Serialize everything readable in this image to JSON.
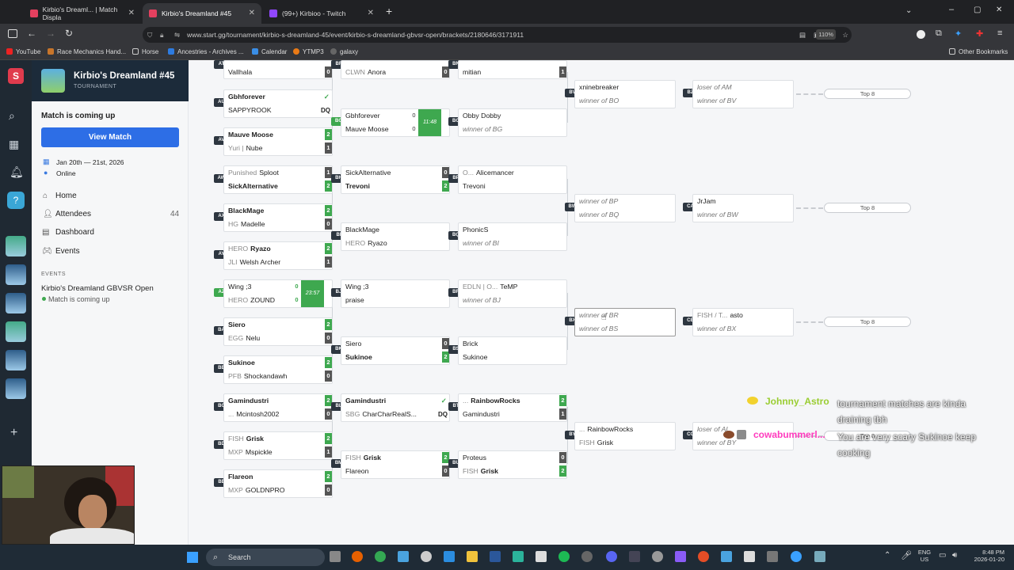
{
  "browser": {
    "tabs": [
      {
        "title": "Kirbio's Dreaml... | Match Displa"
      },
      {
        "title": "Kirbio's Dreamland #45"
      },
      {
        "title": "(99+) Kirbioo - Twitch"
      }
    ],
    "url": "www.start.gg/tournament/kirbio-s-dreamland-45/event/kirbio-s-dreamland-gbvsr-open/brackets/2180646/3171911",
    "zoom": "110%",
    "bookmarks": [
      "YouTube",
      "Race Mechanics Hand...",
      "Horse",
      "Ancestries - Archives ...",
      "Calendar",
      "YTMP3",
      "galaxy"
    ],
    "other_bookmarks": "Other Bookmarks"
  },
  "sidebar": {
    "tournament_name": "Kirbio's Dreamland #45",
    "tournament_tag": "TOURNAMENT",
    "match_status": "Match is coming up",
    "view_match": "View Match",
    "dates": "Jan 20th — 21st, 2026",
    "location": "Online",
    "nav": [
      {
        "label": "Home",
        "count": ""
      },
      {
        "label": "Attendees",
        "count": "44"
      },
      {
        "label": "Dashboard",
        "count": ""
      },
      {
        "label": "Events",
        "count": ""
      }
    ],
    "events_heading": "EVENTS",
    "event_name": "Kirbio's Dreamland GBVSR Open",
    "event_status": "Match is coming up"
  },
  "bracket": {
    "col1": [
      {
        "id": "AT",
        "p1": {
          "pre": "",
          "name": "Vallhala"
        },
        "s1": "0"
      },
      {
        "id": "AU",
        "p1": {
          "pre": "",
          "name": "Gbhforever",
          "b": true,
          "chk": true
        },
        "p2": {
          "pre": "",
          "name": "SAPPYROOK"
        },
        "s2": "DQ"
      },
      {
        "id": "AV",
        "p1": {
          "pre": "",
          "name": "Mauve Moose",
          "b": true
        },
        "s1": "2",
        "p2": {
          "pre": "Yuri |",
          "name": "Nube"
        },
        "s2": "1"
      },
      {
        "id": "AW",
        "p1": {
          "pre": "Punished",
          "name": "Sploot"
        },
        "s1": "1",
        "p2": {
          "pre": "",
          "name": "SickAlternative",
          "b": true
        },
        "s2": "2"
      },
      {
        "id": "AX",
        "p1": {
          "pre": "",
          "name": "BlackMage",
          "b": true
        },
        "s1": "2",
        "p2": {
          "pre": "HG",
          "name": "Madelle"
        },
        "s2": "0"
      },
      {
        "id": "AY",
        "p1": {
          "pre": "HERO",
          "name": "Ryazo",
          "b": true
        },
        "s1": "2",
        "p2": {
          "pre": "JLI",
          "name": "Welsh Archer"
        },
        "s2": "1"
      },
      {
        "id": "AZ",
        "p1": {
          "pre": "",
          "name": "Wing ;3"
        },
        "s1": "0",
        "p2": {
          "pre": "HERO",
          "name": "ZOUND"
        },
        "s2": "0",
        "timer": "23:57"
      },
      {
        "id": "BA",
        "p1": {
          "pre": "",
          "name": "Siero",
          "b": true
        },
        "s1": "2",
        "p2": {
          "pre": "EGG",
          "name": "Nelu"
        },
        "s2": "0"
      },
      {
        "id": "BB",
        "p1": {
          "pre": "",
          "name": "Sukinoe",
          "b": true
        },
        "s1": "2",
        "p2": {
          "pre": "PFB",
          "name": "Shockandawh"
        },
        "s2": "0"
      },
      {
        "id": "BC",
        "p1": {
          "pre": "",
          "name": "Gamindustri",
          "b": true
        },
        "s1": "2",
        "p2": {
          "pre": "...",
          "name": "Mcintosh2002"
        },
        "s2": "0"
      },
      {
        "id": "BD",
        "p1": {
          "pre": "FISH",
          "name": "Grisk",
          "b": true
        },
        "s1": "2",
        "p2": {
          "pre": "MXP",
          "name": "Mspickle"
        },
        "s2": "1"
      },
      {
        "id": "BE",
        "p1": {
          "pre": "",
          "name": "Flareon",
          "b": true
        },
        "s1": "2",
        "p2": {
          "pre": "MXP",
          "name": "GOLDNPRO"
        },
        "s2": "0"
      }
    ],
    "col2": [
      {
        "id": "BF",
        "p1": {
          "pre": "CLWN",
          "name": "Anora"
        },
        "s1": "0"
      },
      {
        "id": "BG",
        "p1": {
          "pre": "",
          "name": "Gbhforever"
        },
        "s1": "0",
        "p2": {
          "pre": "",
          "name": "Mauve Moose"
        },
        "s2": "0",
        "timer": "11:48"
      },
      {
        "id": "BH",
        "p1": {
          "pre": "",
          "name": "SickAlternative"
        },
        "s1": "0",
        "p2": {
          "pre": "",
          "name": "Trevoni",
          "b": true
        },
        "s2": "2"
      },
      {
        "id": "BI",
        "p1": {
          "pre": "",
          "name": "BlackMage"
        },
        "p2": {
          "pre": "HERO",
          "name": "Ryazo"
        }
      },
      {
        "id": "BJ",
        "p1": {
          "pre": "",
          "name": "Wing ;3"
        },
        "p2": {
          "pre": "",
          "name": "praise"
        }
      },
      {
        "id": "BK",
        "p1": {
          "pre": "",
          "name": "Siero"
        },
        "s1": "0",
        "p2": {
          "pre": "",
          "name": "Sukinoe",
          "b": true
        },
        "s2": "2"
      },
      {
        "id": "BL",
        "p1": {
          "pre": "",
          "name": "Gamindustri",
          "b": true,
          "chk": true
        },
        "p2": {
          "pre": "SBG",
          "name": "CharCharRealS..."
        },
        "s2": "DQ"
      },
      {
        "id": "BM",
        "p1": {
          "pre": "FISH",
          "name": "Grisk",
          "b": true
        },
        "s1": "2",
        "p2": {
          "pre": "",
          "name": "Flareon"
        },
        "s2": "0"
      }
    ],
    "col3": [
      {
        "id": "BN",
        "p1": {
          "pre": "",
          "name": "mitian"
        },
        "s1": "1"
      },
      {
        "id": "BO",
        "p1": {
          "pre": "",
          "name": "Obby Dobby"
        },
        "p2": {
          "pre": "",
          "name": "winner of BG",
          "it": true
        }
      },
      {
        "id": "BP",
        "p1": {
          "pre": "O...",
          "name": "Alicemancer"
        },
        "p2": {
          "pre": "",
          "name": "Trevoni"
        }
      },
      {
        "id": "BQ",
        "p1": {
          "pre": "",
          "name": "PhonicS"
        },
        "p2": {
          "pre": "",
          "name": "winner of BI",
          "it": true
        }
      },
      {
        "id": "BR",
        "p1": {
          "pre": "EDLN | O...",
          "name": "TeMP"
        },
        "p2": {
          "pre": "",
          "name": "winner of BJ",
          "it": true
        }
      },
      {
        "id": "BS",
        "p1": {
          "pre": "",
          "name": "Brick"
        },
        "p2": {
          "pre": "",
          "name": "Sukinoe"
        }
      },
      {
        "id": "BT",
        "p1": {
          "pre": "...",
          "name": "RainbowRocks",
          "b": true
        },
        "s1": "2",
        "p2": {
          "pre": "",
          "name": "Gamindustri"
        },
        "s2": "1"
      },
      {
        "id": "BU",
        "p1": {
          "pre": "",
          "name": "Proteus"
        },
        "s1": "0",
        "p2": {
          "pre": "FISH",
          "name": "Grisk",
          "b": true
        },
        "s2": "2"
      }
    ],
    "col4": [
      {
        "id": "BV",
        "p1": {
          "pre": "",
          "name": "xninebreaker"
        },
        "p2": {
          "pre": "",
          "name": "winner of BO",
          "it": true
        }
      },
      {
        "id": "BW",
        "p1": {
          "pre": "",
          "name": "winner of BP",
          "it": true
        },
        "p2": {
          "pre": "",
          "name": "winner of BQ",
          "it": true
        }
      },
      {
        "id": "BX",
        "p1": {
          "pre": "",
          "name": "winner of BR",
          "it": true
        },
        "p2": {
          "pre": "",
          "name": "winner of BS",
          "it": true
        }
      },
      {
        "id": "BY",
        "p1": {
          "pre": "...",
          "name": "RainbowRocks"
        },
        "p2": {
          "pre": "FISH",
          "name": "Grisk"
        }
      }
    ],
    "col5": [
      {
        "id": "BZ",
        "p1": {
          "pre": "",
          "name": "loser of AM",
          "it": true
        },
        "p2": {
          "pre": "",
          "name": "winner of BV",
          "it": true
        }
      },
      {
        "id": "CA",
        "p1": {
          "pre": "",
          "name": "JrJam"
        },
        "p2": {
          "pre": "",
          "name": "winner of BW",
          "it": true
        }
      },
      {
        "id": "CB",
        "p1": {
          "pre": "FISH / T...",
          "name": "asto"
        },
        "p2": {
          "pre": "",
          "name": "winner of BX",
          "it": true
        }
      },
      {
        "id": "CC",
        "p1": {
          "pre": "",
          "name": "loser of AL",
          "it": true
        },
        "p2": {
          "pre": "",
          "name": "winner of BY",
          "it": true
        }
      }
    ],
    "top8_label": "Top 8"
  },
  "chat": [
    {
      "user": "Johnny_Astro",
      "color": "#9acd32",
      "msg": "tournament matches are kinda draining tbh"
    },
    {
      "user": "cowabummerl...",
      "color": "#ff3cbe",
      "msg": "You are very scary Sukinoe keep cooking"
    }
  ],
  "taskbar": {
    "search": "Search",
    "lang": "ENG",
    "region": "US",
    "time": "8:48 PM",
    "date": "2026-01-20"
  }
}
